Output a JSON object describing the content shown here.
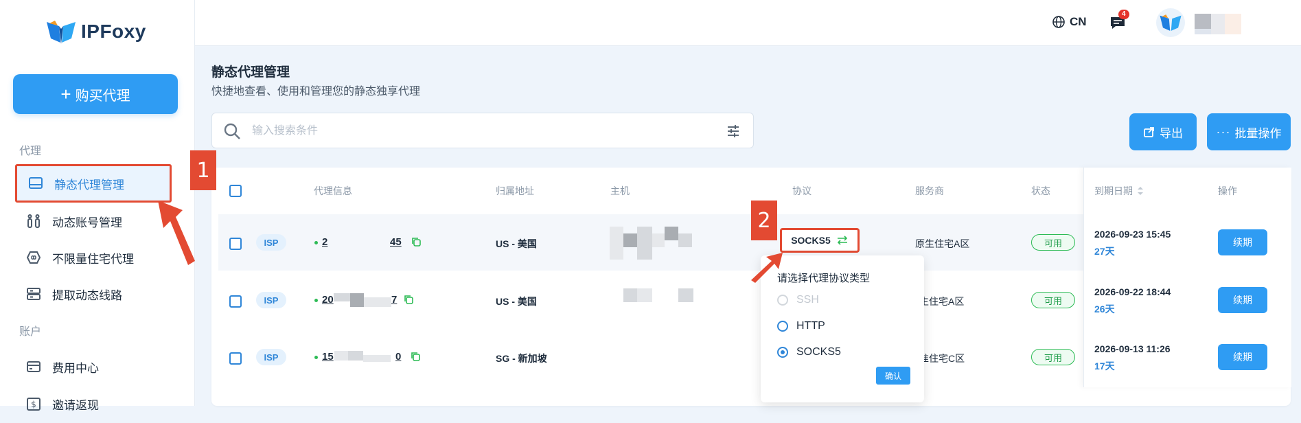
{
  "app": {
    "brand": "IPFoxy"
  },
  "sidebar": {
    "buy_button": "购买代理",
    "section_proxy": "代理",
    "section_account": "账户",
    "items": [
      {
        "label": "静态代理管理",
        "icon": "monitor-icon",
        "active": true
      },
      {
        "label": "动态账号管理",
        "icon": "sliders-icon"
      },
      {
        "label": "不限量住宅代理",
        "icon": "infinity-icon"
      },
      {
        "label": "提取动态线路",
        "icon": "server-icon"
      },
      {
        "label": "费用中心",
        "icon": "card-icon"
      },
      {
        "label": "邀请返现",
        "icon": "dollar-icon"
      }
    ]
  },
  "header": {
    "language": "CN",
    "notification_count": "4"
  },
  "page": {
    "title": "静态代理管理",
    "subtitle": "快捷地查看、使用和管理您的静态独享代理"
  },
  "search": {
    "placeholder": "输入搜索条件"
  },
  "actions": {
    "export": "导出",
    "batch": "批量操作"
  },
  "table": {
    "columns": [
      "代理信息",
      "归属地址",
      "主机",
      "协议",
      "服务商",
      "状态",
      "到期日期",
      "操作"
    ],
    "rows": [
      {
        "tag": "ISP",
        "ip_start": "2",
        "ip_end": "45",
        "location": "US - 美国",
        "protocol": "SOCKS5",
        "provider": "原生住宅A区",
        "status": "可用",
        "expiry": "2026-09-23 15:45",
        "days": "27天",
        "action": "续期"
      },
      {
        "tag": "ISP",
        "ip_start": "20",
        "ip_end": "7",
        "location": "US - 美国",
        "provider": "生住宅A区",
        "status": "可用",
        "expiry": "2026-09-22 18:44",
        "days": "26天",
        "action": "续期"
      },
      {
        "tag": "ISP",
        "ip_start": "15",
        "ip_end": "0",
        "location": "SG - 新加坡",
        "provider": "准住宅C区",
        "status": "可用",
        "expiry": "2026-09-13 11:26",
        "days": "17天",
        "action": "续期"
      }
    ]
  },
  "protocol_dropdown": {
    "title": "请选择代理协议类型",
    "options": [
      {
        "label": "SSH",
        "state": "disabled"
      },
      {
        "label": "HTTP",
        "state": "unselected"
      },
      {
        "label": "SOCKS5",
        "state": "selected"
      }
    ],
    "confirm": "确认"
  },
  "annotations": {
    "step1": "1",
    "step2": "2"
  },
  "colors": {
    "accent": "#2f9cf3",
    "highlight": "#e34a32",
    "success": "#2dbb55"
  }
}
